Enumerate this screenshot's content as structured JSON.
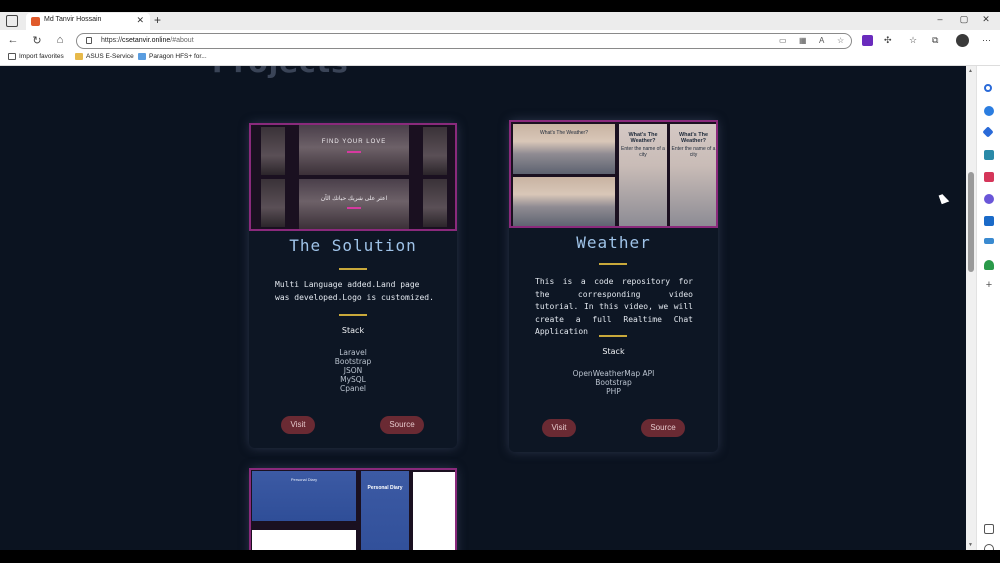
{
  "browser": {
    "tab_title": "Md Tanvir Hossain",
    "tab_close": "✕",
    "new_tab": "+",
    "url_prefix": "https://",
    "url_host": "csetanvir.online",
    "url_path": "/#about",
    "window_controls": {
      "minimize": "–",
      "maximize": "▢",
      "close": "✕"
    },
    "bookmarks": [
      {
        "label": "Import favorites",
        "icon": "import-icon"
      },
      {
        "label": "ASUS E-Service",
        "icon": "folder-icon"
      },
      {
        "label": "Paragon HFS+ for...",
        "icon": "paragon-icon"
      }
    ]
  },
  "page": {
    "section_title": "Projects",
    "projects": [
      {
        "title": "The Solution",
        "image_text_top": "FIND YOUR LOVE",
        "image_text_bottom": "اعثر على شريك حياتك الآن",
        "description": "Multi Language added.Land page was developed.Logo is customized.",
        "stack_heading": "Stack",
        "stack": [
          "Laravel",
          "Bootstrap",
          "JSON",
          "MySQL",
          "Cpanel"
        ],
        "visit_label": "Visit",
        "source_label": "Source"
      },
      {
        "title": "Weather",
        "image_text_a": "What's The Weather?",
        "image_text_b": "Enter the name of a city",
        "description": "This is a code repository for the corresponding video tutorial. In this video, we will create a full Realtime Chat Application",
        "stack_heading": "Stack",
        "stack": [
          "OpenWeatherMap API",
          "Bootstrap",
          "PHP"
        ],
        "visit_label": "Visit",
        "source_label": "Source"
      },
      {
        "image_text": "Personal Diary"
      }
    ]
  },
  "colors": {
    "page_bg": "#0b1320",
    "card_bg": "#0d1624",
    "title_color": "#9fc3e8",
    "divider": "#c9a93b",
    "button_bg": "#6a2a33",
    "image_border": "#8a2a7c"
  }
}
